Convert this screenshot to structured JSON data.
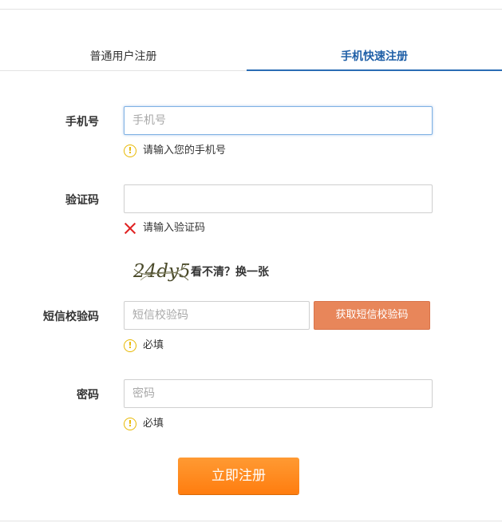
{
  "tabs": {
    "normal": "普通用户注册",
    "phone": "手机快速注册"
  },
  "form": {
    "phone": {
      "label": "手机号",
      "placeholder": "手机号",
      "hint": "请输入您的手机号"
    },
    "captcha": {
      "label": "验证码",
      "placeholder": "",
      "error": "请输入验证码",
      "image_text": "24dy5",
      "refresh": "看不清？换一张"
    },
    "sms": {
      "label": "短信校验码",
      "placeholder": "短信校验码",
      "button": "获取短信校验码",
      "hint": "必填"
    },
    "password": {
      "label": "密码",
      "placeholder": "密码",
      "hint": "必填"
    },
    "submit": "立即注册"
  },
  "colors": {
    "accent_tab": "#2a6cb4",
    "sms_button": "#e8865a",
    "submit_button": "#ff7d0f",
    "warning": "#e8b800",
    "error": "#e02222"
  },
  "icons": {
    "warning": "warning-circle-icon",
    "error": "error-x-icon"
  }
}
